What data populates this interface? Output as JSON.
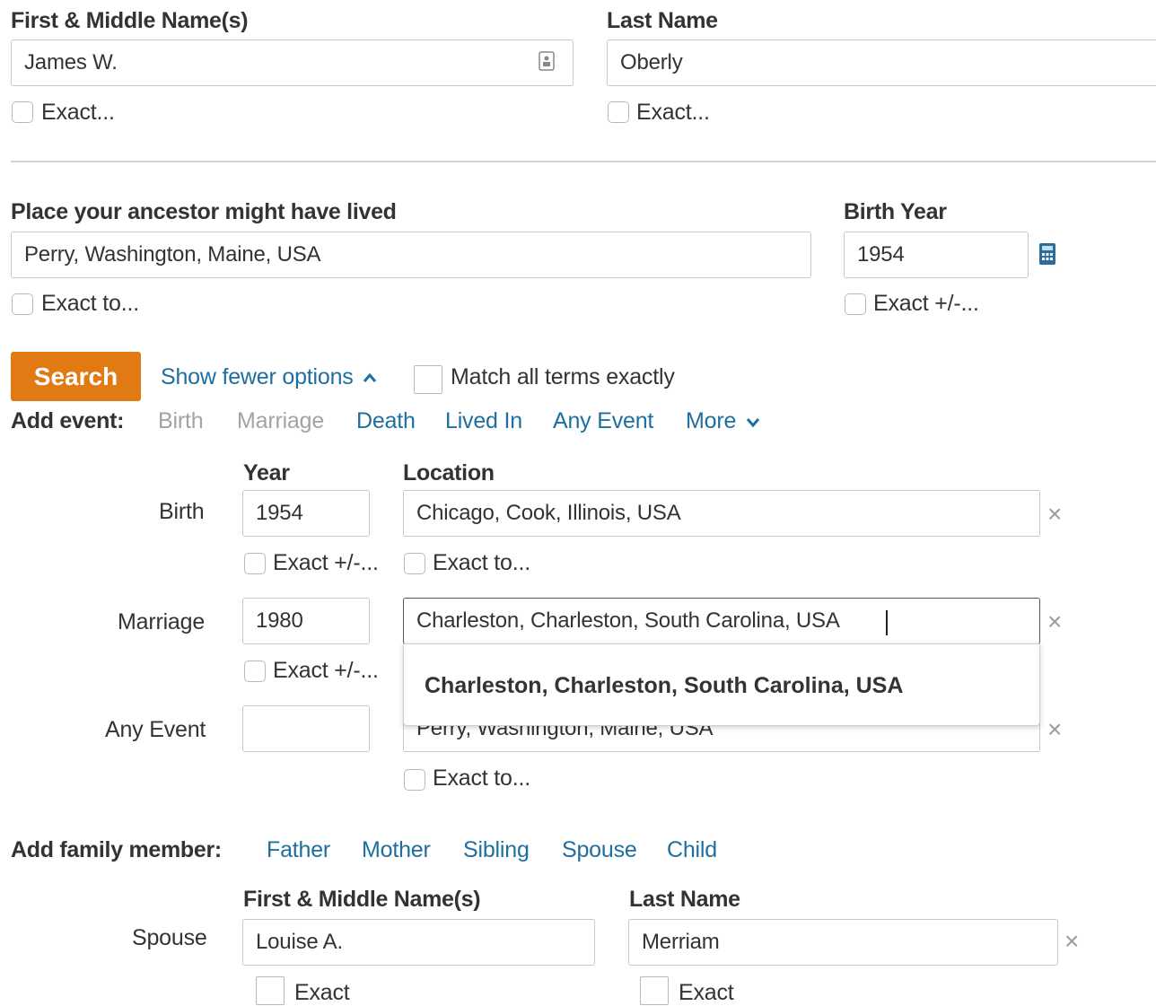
{
  "name": {
    "first_label": "First & Middle Name(s)",
    "first_value": "James W.",
    "last_label": "Last Name",
    "last_value": "Oberly",
    "exact_label": "Exact..."
  },
  "residence": {
    "label": "Place your ancestor might have lived",
    "value": "Perry, Washington, Maine, USA",
    "exact_label": "Exact to..."
  },
  "birth_year": {
    "label": "Birth Year",
    "value": "1954",
    "exact_label": "Exact +/-..."
  },
  "actions": {
    "search_label": "Search",
    "show_fewer_label": "Show fewer options",
    "match_all_label": "Match all terms exactly"
  },
  "add_event": {
    "label": "Add event:",
    "items": [
      "Birth",
      "Marriage",
      "Death",
      "Lived In",
      "Any Event",
      "More"
    ]
  },
  "events": {
    "year_header": "Year",
    "location_header": "Location",
    "exact_year_label": "Exact +/-...",
    "exact_location_label": "Exact to...",
    "rows": [
      {
        "label": "Birth",
        "year": "1954",
        "location": "Chicago, Cook, Illinois, USA"
      },
      {
        "label": "Marriage",
        "year": "1980",
        "location": "Charleston, Charleston, South Carolina, USA"
      },
      {
        "label": "Any Event",
        "year": "",
        "location": "Perry, Washington, Maine, USA"
      }
    ],
    "suggestion": "Charleston, Charleston, South Carolina, USA"
  },
  "add_family": {
    "label": "Add family member:",
    "items": [
      "Father",
      "Mother",
      "Sibling",
      "Spouse",
      "Child"
    ]
  },
  "family": {
    "first_header": "First & Middle Name(s)",
    "last_header": "Last Name",
    "rows": [
      {
        "label": "Spouse",
        "first": "Louise A.",
        "last": "Merriam"
      }
    ],
    "exact_label": "Exact"
  },
  "icons": {
    "close": "×",
    "chevron_up": "chevron-up-icon",
    "chevron_down": "chevron-down-icon",
    "calculator": "calculator-icon",
    "contact_card": "contact-card-icon"
  },
  "colors": {
    "accent": "#e17a12",
    "link": "#1e6f9f",
    "disabled_link": "#a3a3a3",
    "text": "#333333"
  }
}
